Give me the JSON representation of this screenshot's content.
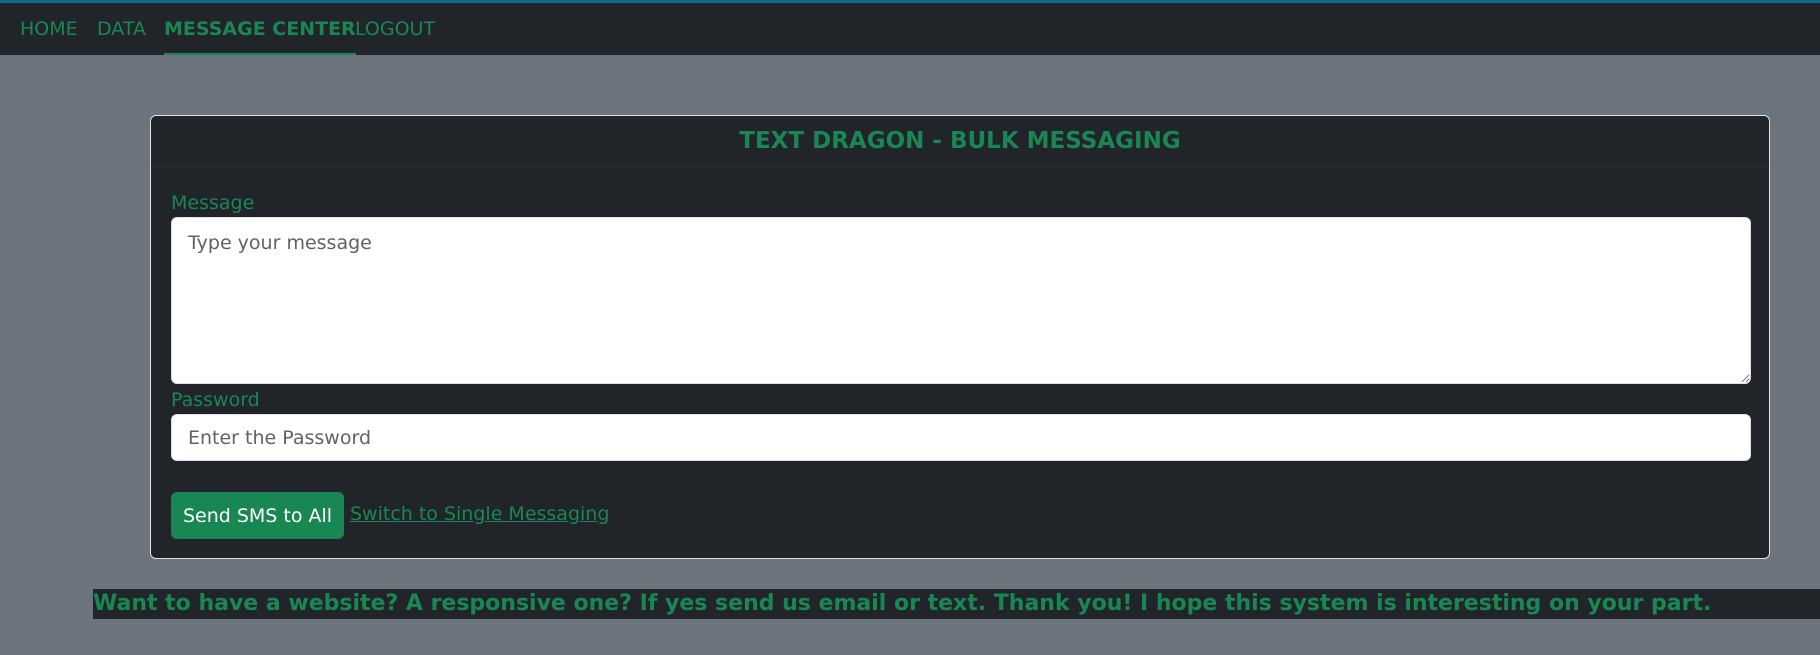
{
  "nav": {
    "items": [
      {
        "label": "HOME"
      },
      {
        "label": "DATA"
      },
      {
        "label": "MESSAGE CENTER"
      },
      {
        "label": "LOGOUT"
      }
    ],
    "active": "MESSAGE CENTER"
  },
  "card": {
    "title": "TEXT DRAGON - BULK MESSAGING",
    "message_label": "Message",
    "message_placeholder": "Type your message",
    "message_value": "",
    "password_label": "Password",
    "password_placeholder": "Enter the Password",
    "password_value": "",
    "send_button": "Send SMS to All",
    "switch_link": "Switch to Single Messaging"
  },
  "banner": {
    "text": "Want to have a website? A responsive one? If yes send us email or text. Thank you! I hope this system is interesting on your part."
  },
  "colors": {
    "accent": "#198754",
    "dark": "#212529",
    "background": "#6c757d"
  }
}
